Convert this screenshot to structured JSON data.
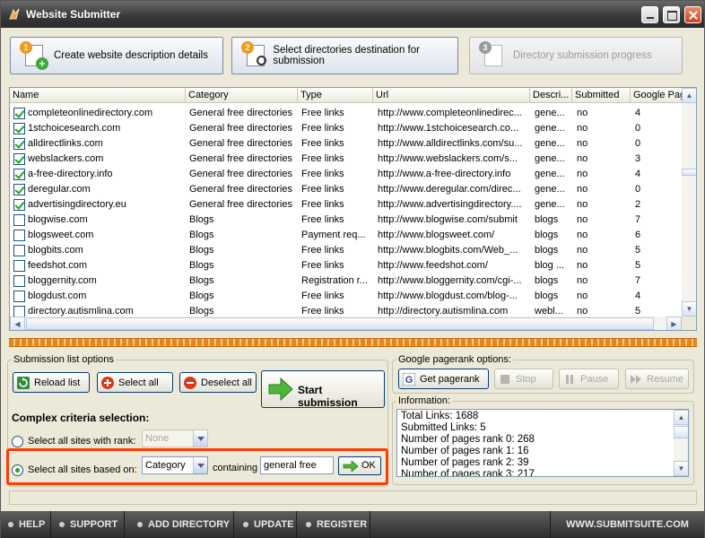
{
  "window": {
    "title": "Website Submitter"
  },
  "steps": [
    {
      "number": "1",
      "label": "Create website description details"
    },
    {
      "number": "2",
      "label": "Select directories destination for submission"
    },
    {
      "number": "3",
      "label": "Directory submission progress"
    }
  ],
  "grid": {
    "columns": [
      "Name",
      "Category",
      "Type",
      "Url",
      "Descri...",
      "Submitted",
      "Google Pag"
    ],
    "rows": [
      {
        "checked": true,
        "name": "completeonlinedirectory.com",
        "category": "General free directories",
        "type": "Free links",
        "url": "http://www.completeonlinedirec...",
        "desc": "gene...",
        "submitted": "no",
        "pr": "4"
      },
      {
        "checked": true,
        "name": "1stchoicesearch.com",
        "category": "General free directories",
        "type": "Free links",
        "url": "http://www.1stchoicesearch.co...",
        "desc": "gene...",
        "submitted": "no",
        "pr": "0"
      },
      {
        "checked": true,
        "name": "alldirectlinks.com",
        "category": "General free directories",
        "type": "Free links",
        "url": "http://www.alldirectlinks.com/su...",
        "desc": "gene...",
        "submitted": "no",
        "pr": "0"
      },
      {
        "checked": true,
        "name": "webslackers.com",
        "category": "General free directories",
        "type": "Free links",
        "url": "http://www.webslackers.com/s...",
        "desc": "gene...",
        "submitted": "no",
        "pr": "3"
      },
      {
        "checked": true,
        "name": "a-free-directory.info",
        "category": "General free directories",
        "type": "Free links",
        "url": "http://www.a-free-directory.info",
        "desc": "gene...",
        "submitted": "no",
        "pr": "4"
      },
      {
        "checked": true,
        "name": "deregular.com",
        "category": "General free directories",
        "type": "Free links",
        "url": "http://www.deregular.com/direc...",
        "desc": "gene...",
        "submitted": "no",
        "pr": "0"
      },
      {
        "checked": true,
        "name": "advertisingdirectory.eu",
        "category": "General free directories",
        "type": "Free links",
        "url": "http://www.advertisingdirectory....",
        "desc": "gene...",
        "submitted": "no",
        "pr": "2"
      },
      {
        "checked": false,
        "name": "blogwise.com",
        "category": "Blogs",
        "type": "Free links",
        "url": "http://www.blogwise.com/submit",
        "desc": "blogs",
        "submitted": "no",
        "pr": "7"
      },
      {
        "checked": false,
        "name": "blogsweet.com",
        "category": "Blogs",
        "type": "Payment req...",
        "url": "http://www.blogsweet.com/",
        "desc": "blogs",
        "submitted": "no",
        "pr": "6"
      },
      {
        "checked": false,
        "name": "blogbits.com",
        "category": "Blogs",
        "type": "Free links",
        "url": "http://www.blogbits.com/Web_...",
        "desc": "blogs",
        "submitted": "no",
        "pr": "5"
      },
      {
        "checked": false,
        "name": "feedshot.com",
        "category": "Blogs",
        "type": "Free links",
        "url": "http://www.feedshot.com/",
        "desc": "blog ...",
        "submitted": "no",
        "pr": "5"
      },
      {
        "checked": false,
        "name": "bloggernity.com",
        "category": "Blogs",
        "type": "Registration r...",
        "url": "http://www.bloggernity.com/cgi-...",
        "desc": "blogs",
        "submitted": "no",
        "pr": "7"
      },
      {
        "checked": false,
        "name": "blogdust.com",
        "category": "Blogs",
        "type": "Free links",
        "url": "http://www.blogdust.com/blog-...",
        "desc": "blogs",
        "submitted": "no",
        "pr": "4"
      },
      {
        "checked": false,
        "name": "directory.autismlina.com",
        "category": "Blogs",
        "type": "Free links",
        "url": "http://directory.autismlina.com",
        "desc": "webl...",
        "submitted": "no",
        "pr": "5"
      }
    ]
  },
  "submission_options": {
    "legend": "Submission list options",
    "reload": "Reload list",
    "select_all": "Select all",
    "deselect_all": "Deselect all",
    "start": "Start submission",
    "criteria_title": "Complex criteria selection:",
    "rank_label": "Select all sites with rank:",
    "rank_value": "None",
    "based_label": "Select all sites based on:",
    "based_value": "Category",
    "containing": "containing",
    "filter_text": "general free",
    "ok": "OK"
  },
  "pagerank": {
    "legend": "Google pagerank options:",
    "get": "Get pagerank",
    "stop": "Stop",
    "pause": "Pause",
    "resume": "Resume"
  },
  "information": {
    "legend": "Information:",
    "lines": [
      "Total Links:     1688",
      "Submitted Links: 5",
      "Number of pages rank 0: 268",
      "Number of pages rank 1: 16",
      "Number of pages rank 2: 39",
      "Number of pages rank 3: 217"
    ]
  },
  "footer": {
    "items": [
      "HELP",
      "SUPPORT",
      "ADD DIRECTORY",
      "UPDATE",
      "REGISTER"
    ],
    "site": "WWW.SUBMITSUITE.COM"
  }
}
